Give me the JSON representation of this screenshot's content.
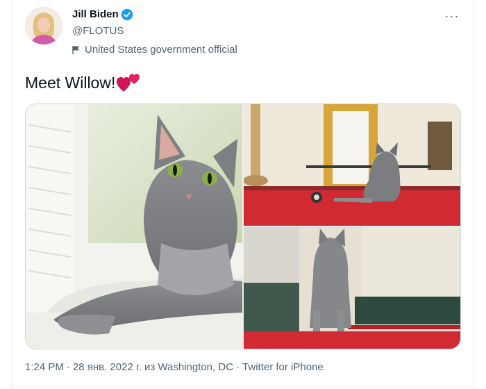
{
  "author": {
    "name": "Jill Biden",
    "handle": "@FLOTUS",
    "label": "United States government official"
  },
  "menu": {
    "more_icon": "more-horizontal-icon",
    "more_label": "···"
  },
  "tweet": {
    "text": "Meet Willow!",
    "emoji_icon": "two-hearts-icon"
  },
  "media": {
    "images": [
      {
        "name": "cat-on-windowsill"
      },
      {
        "name": "cat-in-red-carpet-room"
      },
      {
        "name": "cat-standing-in-hallway"
      }
    ]
  },
  "meta": {
    "time": "1:24 PM",
    "separator": "·",
    "date_location": "28 янв. 2022 г. из Washington, DC",
    "source": "Twitter for iPhone"
  },
  "colors": {
    "verified_blue": "#1d9bf0",
    "secondary_text": "#536471",
    "primary_text": "#0f1419",
    "heart_red": "#d4145a"
  }
}
